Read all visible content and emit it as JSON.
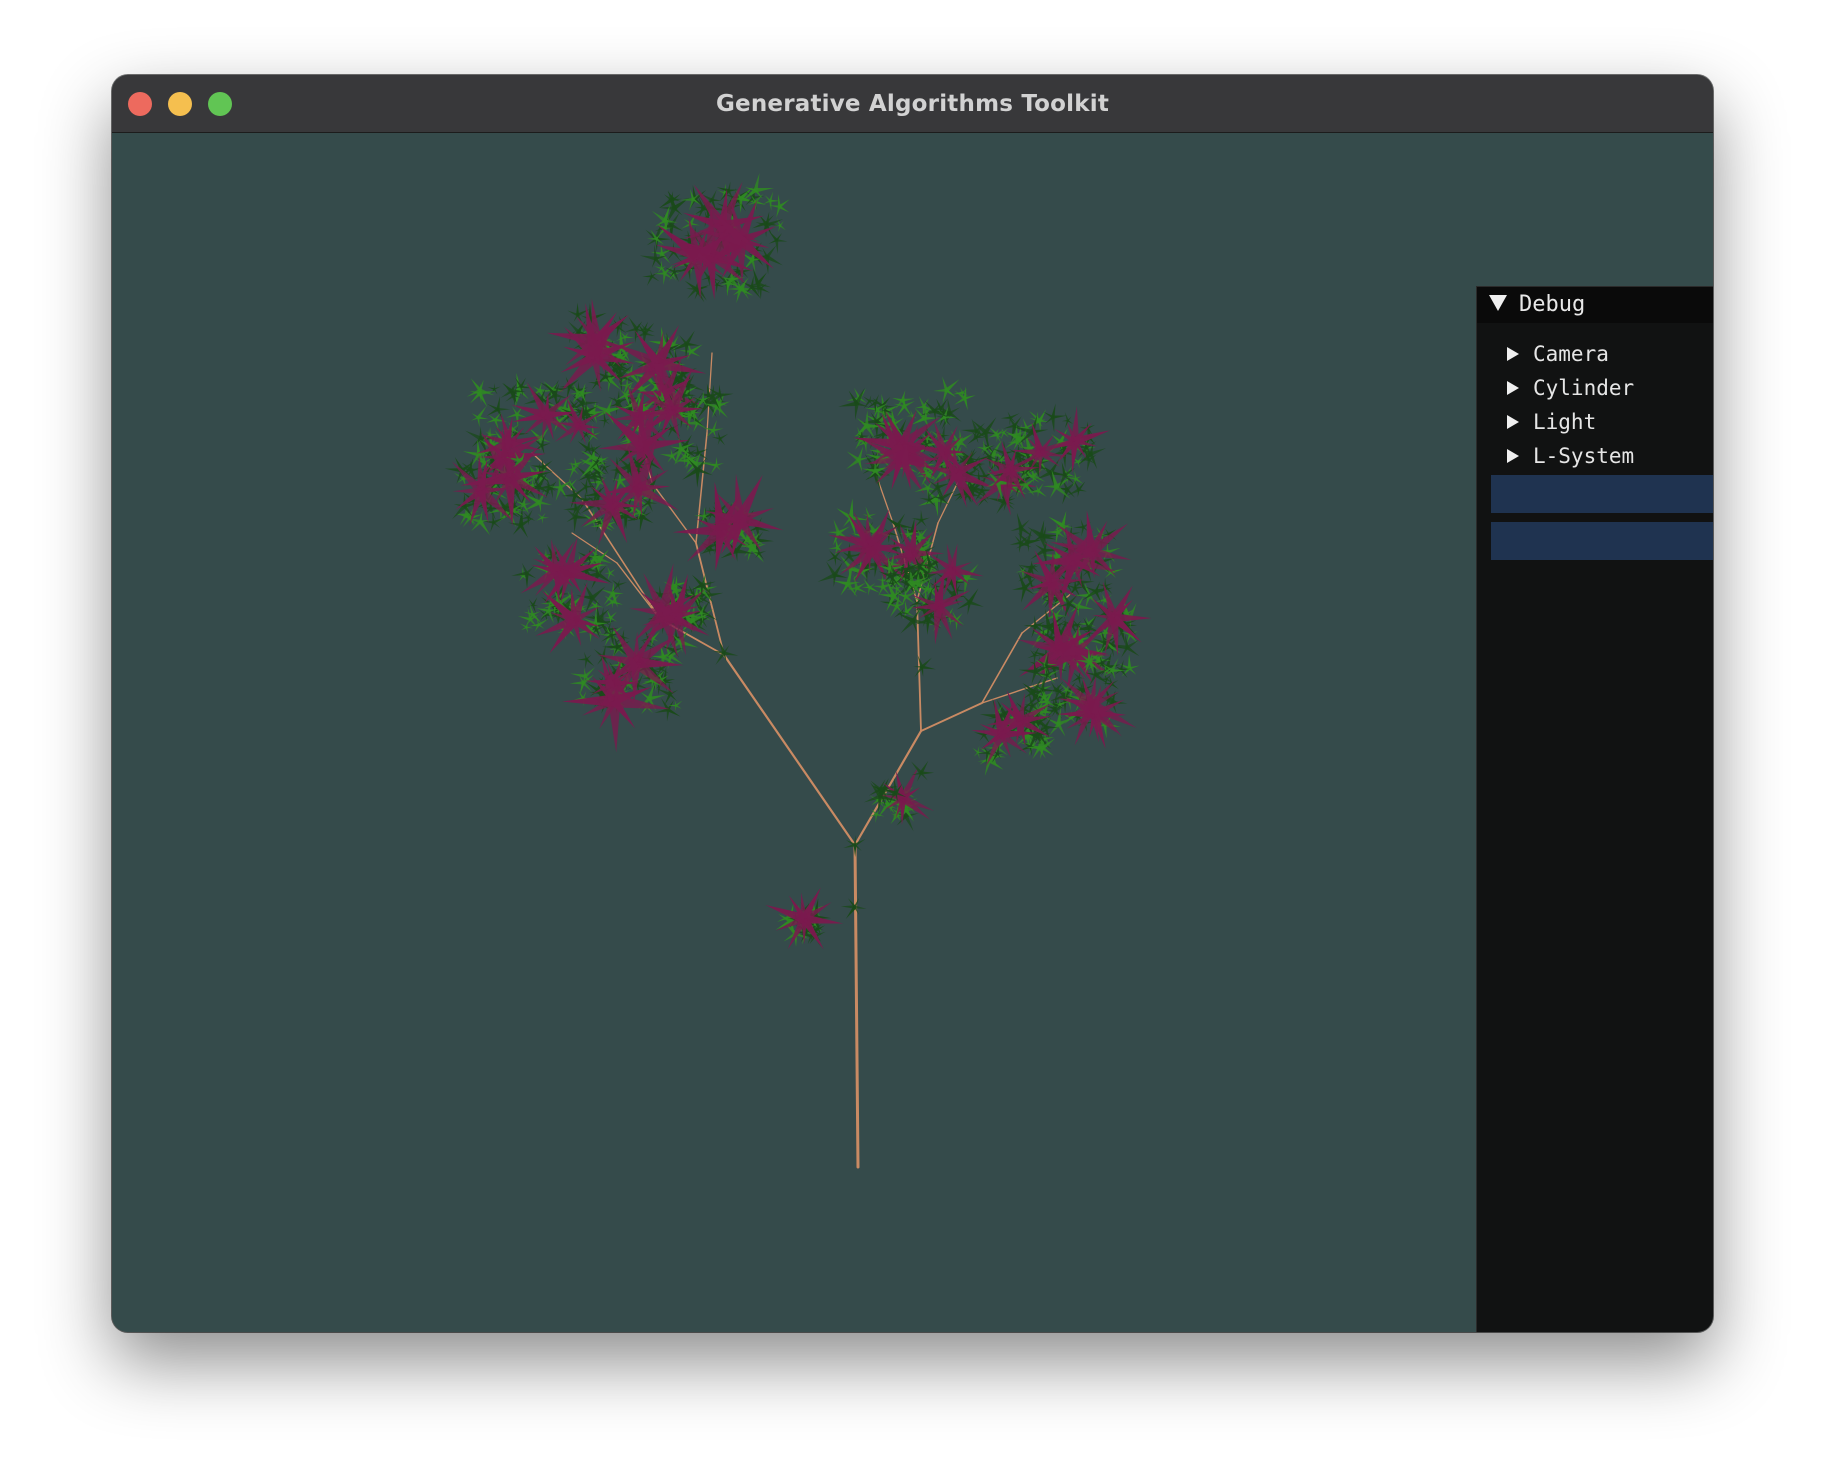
{
  "window": {
    "title": "Generative Algorithms Toolkit"
  },
  "traffic_lights": {
    "close": "#ed6a5e",
    "minimize": "#f5bf4f",
    "zoom": "#61c554"
  },
  "viewport": {
    "background_color": "#354b4b",
    "scene": "l-system-tree",
    "colors": {
      "branch": "#c98a63",
      "leaf_green": "#1a4a1a",
      "leaf_bright": "#2f8a22",
      "leaf_purple": "#7a1a4e"
    }
  },
  "debug": {
    "header": "Debug",
    "items": [
      {
        "label": "Camera"
      },
      {
        "label": "Cylinder"
      },
      {
        "label": "Light"
      },
      {
        "label": "L-System"
      }
    ],
    "slot_color": "#1f3350"
  }
}
